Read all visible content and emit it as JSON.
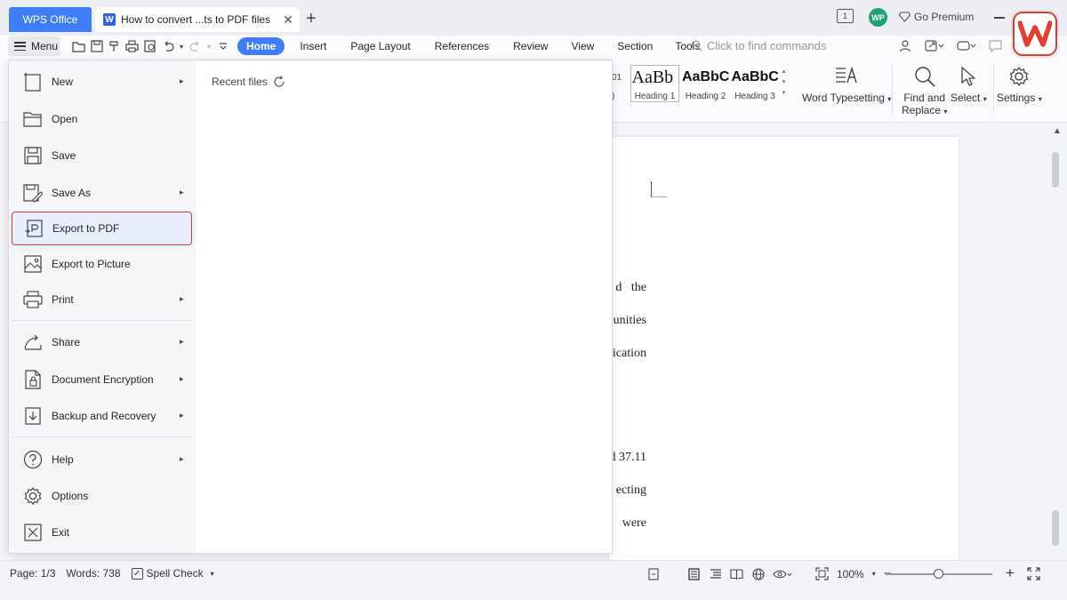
{
  "titlebar": {
    "app_tab": "WPS Office",
    "doc_tab_icon": "W",
    "doc_tab_title": "How to convert ...ts to PDF files",
    "close_symbol": "✕",
    "new_tab_symbol": "+",
    "panel_icon_label": "1",
    "avatar_initials": "WP",
    "premium_label": "Go Premium"
  },
  "menubar": {
    "menu_label": "Menu",
    "tabs": [
      "Home",
      "Insert",
      "Page Layout",
      "References",
      "Review",
      "View",
      "Section",
      "Tools"
    ],
    "active_tab": "Home",
    "search_placeholder": "Click to find commands"
  },
  "ribbon": {
    "styles": [
      {
        "sample": "AaBb",
        "name": "Heading 1"
      },
      {
        "sample": "AaBbC",
        "name": "Heading 2"
      },
      {
        "sample": "AaBbCc",
        "name": "Heading 3"
      }
    ],
    "partial_left_text": "01",
    "partial_left_text2": ")",
    "word_typesetting": "Word Typesetting",
    "find_replace_line1": "Find and",
    "find_replace_line2": "Replace",
    "select": "Select",
    "settings": "Settings",
    "dropdown_caret": "▾"
  },
  "menu_dropdown": {
    "items": [
      {
        "label": "New",
        "icon": "new-doc-icon",
        "has_submenu": true
      },
      {
        "label": "Open",
        "icon": "folder-icon",
        "has_submenu": false
      },
      {
        "label": "Save",
        "icon": "save-icon",
        "has_submenu": false
      },
      {
        "label": "Save As",
        "icon": "save-as-icon",
        "has_submenu": true
      },
      {
        "label": "Export to PDF",
        "icon": "export-pdf-icon",
        "has_submenu": false,
        "highlighted": true
      },
      {
        "label": "Export to Picture",
        "icon": "export-picture-icon",
        "has_submenu": false
      },
      {
        "label": "Print",
        "icon": "print-icon",
        "has_submenu": true
      },
      {
        "label": "Share",
        "icon": "share-icon",
        "has_submenu": true
      },
      {
        "label": "Document Encryption",
        "icon": "encryption-icon",
        "has_submenu": true
      },
      {
        "label": "Backup and Recovery",
        "icon": "backup-icon",
        "has_submenu": true
      },
      {
        "label": "Help",
        "icon": "help-icon",
        "has_submenu": true
      },
      {
        "label": "Options",
        "icon": "gear-icon",
        "has_submenu": false
      },
      {
        "label": "Exit",
        "icon": "exit-icon",
        "has_submenu": false
      }
    ],
    "submenu_arrow": "▸",
    "recent_files_label": "Recent files"
  },
  "document": {
    "visible_fragments": [
      "d   the",
      "unities",
      "ication",
      "d 37.11",
      "ecting",
      "s   were"
    ]
  },
  "statusbar": {
    "page": "Page: 1/3",
    "words": "Words: 738",
    "spell_check": "Spell Check",
    "spell_caret": "▾",
    "zoom": "100%",
    "zoom_caret": "▾",
    "zoom_level": 0.5,
    "minus": "−",
    "plus": "+"
  },
  "colors": {
    "accent": "#3f7ef7",
    "highlight_border": "#e0393b",
    "wps_logo": "#e43c2f",
    "avatar": "#20a372"
  }
}
